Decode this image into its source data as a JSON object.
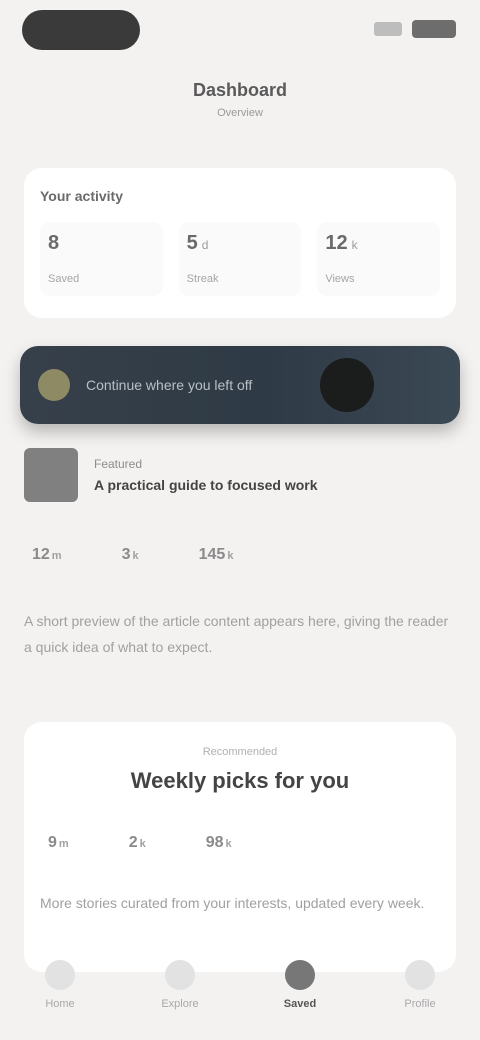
{
  "header": {
    "title": "Dashboard",
    "subtitle": "Overview"
  },
  "stats": {
    "label": "Your activity",
    "items": [
      {
        "value": "8",
        "unit": "",
        "label": "Saved"
      },
      {
        "value": "5",
        "unit": "d",
        "label": "Streak"
      },
      {
        "value": "12",
        "unit": "k",
        "label": "Views"
      }
    ]
  },
  "banner": {
    "text": "Continue where you left off"
  },
  "post": {
    "author": "Featured",
    "title": "A practical guide to focused work",
    "metrics": [
      {
        "value": "12",
        "unit": "m"
      },
      {
        "value": "3",
        "unit": "k"
      },
      {
        "value": "145",
        "unit": "k"
      }
    ],
    "body": "A short preview of the article content appears here, giving the reader a quick idea of what to expect."
  },
  "section": {
    "kicker": "Recommended",
    "title": "Weekly picks for you",
    "metrics": [
      {
        "value": "9",
        "unit": "m"
      },
      {
        "value": "2",
        "unit": "k"
      },
      {
        "value": "98",
        "unit": "k"
      }
    ],
    "body": "More stories curated from your interests, updated every week."
  },
  "tabs": [
    {
      "label": "Home"
    },
    {
      "label": "Explore"
    },
    {
      "label": "Saved"
    },
    {
      "label": "Profile"
    }
  ]
}
